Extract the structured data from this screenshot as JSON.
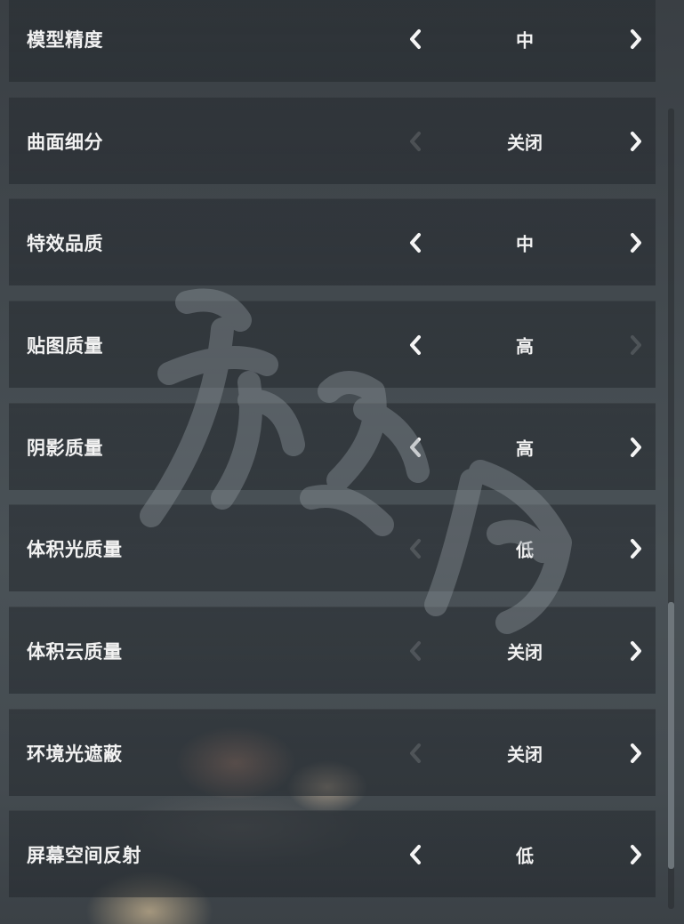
{
  "settings": [
    {
      "label": "模型精度",
      "value": "中",
      "left_enabled": true,
      "right_enabled": true
    },
    {
      "label": "曲面细分",
      "value": "关闭",
      "left_enabled": false,
      "right_enabled": true
    },
    {
      "label": "特效品质",
      "value": "中",
      "left_enabled": true,
      "right_enabled": true
    },
    {
      "label": "贴图质量",
      "value": "高",
      "left_enabled": true,
      "right_enabled": false
    },
    {
      "label": "阴影质量",
      "value": "高",
      "left_enabled": true,
      "right_enabled": true
    },
    {
      "label": "体积光质量",
      "value": "低",
      "left_enabled": false,
      "right_enabled": true
    },
    {
      "label": "体积云质量",
      "value": "关闭",
      "left_enabled": false,
      "right_enabled": true
    },
    {
      "label": "环境光遮蔽",
      "value": "关闭",
      "left_enabled": false,
      "right_enabled": true
    },
    {
      "label": "屏幕空间反射",
      "value": "低",
      "left_enabled": true,
      "right_enabled": true
    }
  ],
  "icons": {
    "prev": "chevron-left-icon",
    "next": "chevron-right-icon"
  },
  "colors": {
    "text": "#f2f2f2",
    "arrow_disabled": "rgba(255,255,255,0.14)"
  }
}
